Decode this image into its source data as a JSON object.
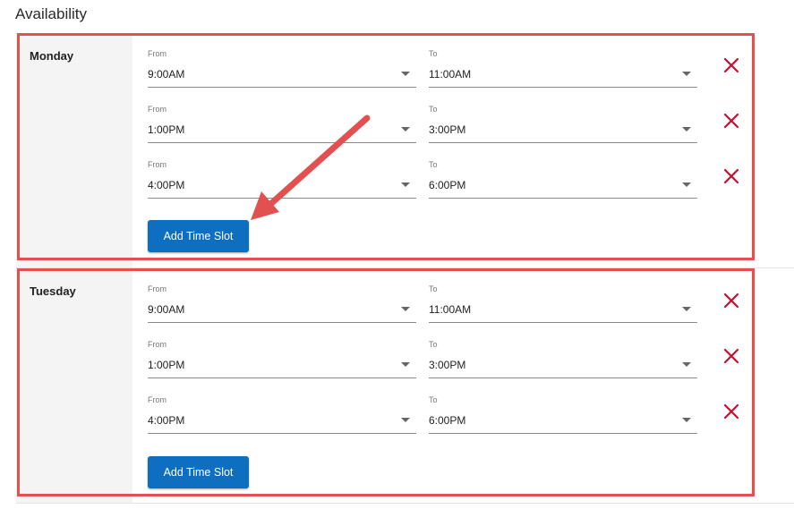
{
  "page": {
    "title": "Availability"
  },
  "days": [
    {
      "name": "Monday",
      "slots": [
        {
          "from_label": "From",
          "from": "9:00AM",
          "to_label": "To",
          "to": "11:00AM"
        },
        {
          "from_label": "From",
          "from": "1:00PM",
          "to_label": "To",
          "to": "3:00PM"
        },
        {
          "from_label": "From",
          "from": "4:00PM",
          "to_label": "To",
          "to": "6:00PM"
        }
      ],
      "add_label": "Add Time Slot"
    },
    {
      "name": "Tuesday",
      "slots": [
        {
          "from_label": "From",
          "from": "9:00AM",
          "to_label": "To",
          "to": "11:00AM"
        },
        {
          "from_label": "From",
          "from": "1:00PM",
          "to_label": "To",
          "to": "3:00PM"
        },
        {
          "from_label": "From",
          "from": "4:00PM",
          "to_label": "To",
          "to": "6:00PM"
        }
      ],
      "add_label": "Add Time Slot"
    }
  ],
  "icons": {
    "remove": "close-x-icon",
    "dropdown": "caret-down-icon",
    "annotation": "red-arrow"
  },
  "colors": {
    "highlight": "#e2514f",
    "button": "#0e6fc1",
    "remove": "#c8102e"
  }
}
